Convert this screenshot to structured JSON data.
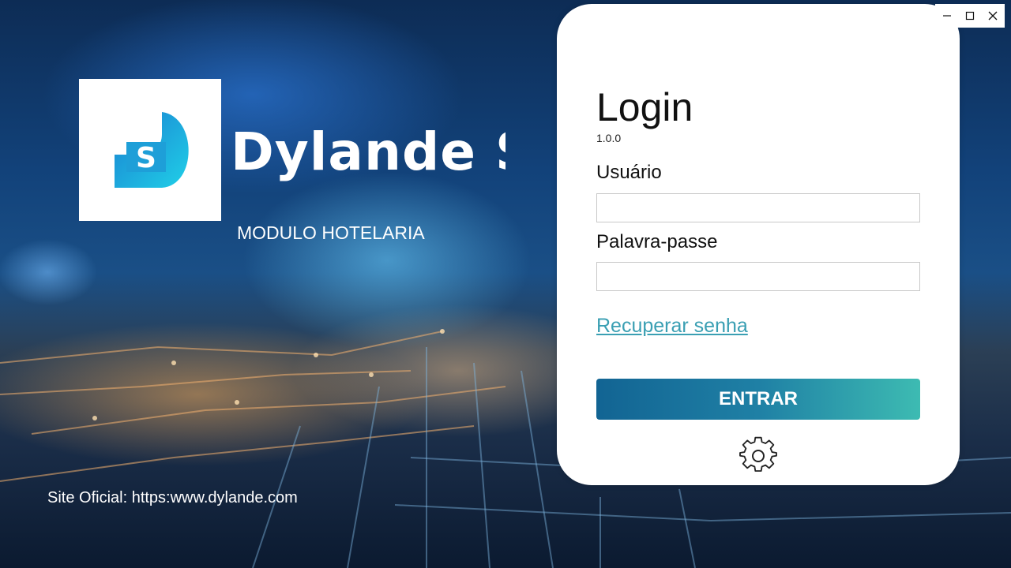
{
  "brand": {
    "name": "Dylande Software",
    "module": "MODULO HOTELARIA",
    "site": "Site Oficial: https:www.dylande.com",
    "logo_letter": "S"
  },
  "login": {
    "title": "Login",
    "version": "1.0.0",
    "user_label": "Usuário",
    "user_value": "",
    "password_label": "Palavra-passe",
    "password_value": "",
    "recover_link": "Recuperar senha",
    "submit_label": "ENTRAR",
    "settings_icon": "gear-icon"
  },
  "window": {
    "controls": [
      "minimize-icon",
      "maximize-icon",
      "close-icon"
    ]
  },
  "colors": {
    "button_start": "#126493",
    "button_end": "#3dbbb2",
    "link": "#3a9fb3",
    "logo_cyan": "#1ab8e0"
  }
}
